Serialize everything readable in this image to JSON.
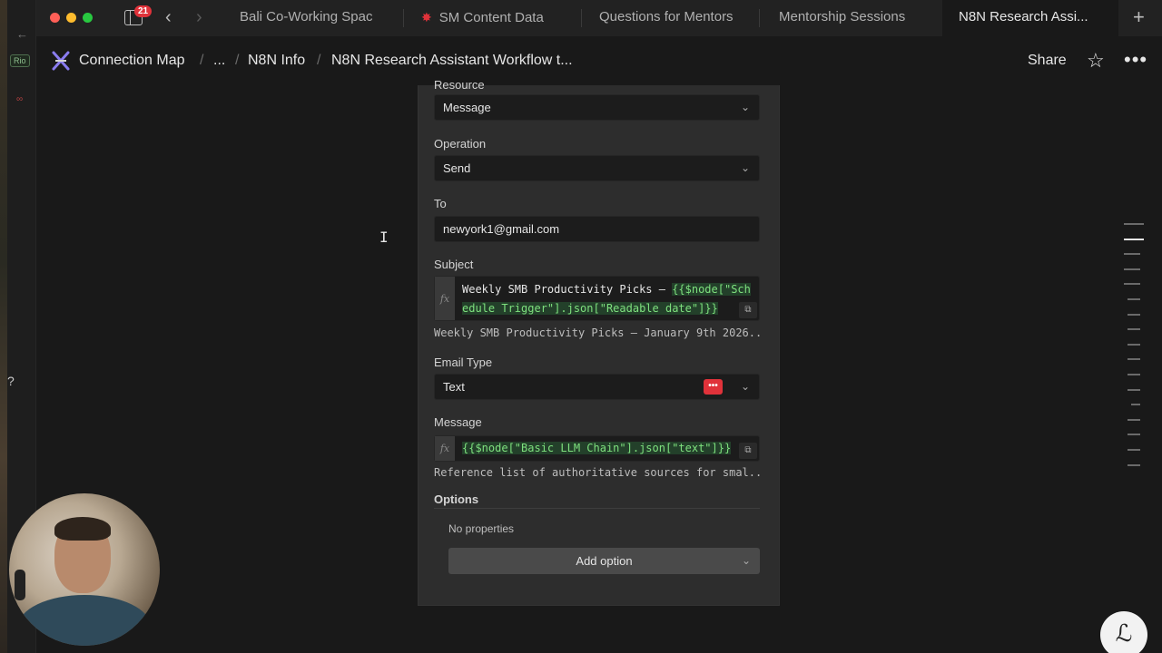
{
  "browser": {
    "tab_count_badge": "21",
    "tabs": [
      {
        "label": "Bali Co-Working Spac"
      },
      {
        "label": "SM Content Data"
      },
      {
        "label": "Questions for Mentors"
      },
      {
        "label": "Mentorship Sessions"
      },
      {
        "label": "N8N Research Assi..."
      }
    ],
    "icons": {
      "back": "chevron-left-icon",
      "forward": "chevron-right-icon",
      "new_tab": "plus-icon"
    }
  },
  "mini_sidebar": {
    "tag": "Rio"
  },
  "header": {
    "workspace": "Connection Map",
    "ellipsis": "...",
    "parent": "N8N Info",
    "page_title": "N8N Research Assistant Workflow t...",
    "share_label": "Share"
  },
  "form": {
    "resource_label": "Resource",
    "resource_value": "Message",
    "operation_label": "Operation",
    "operation_value": "Send",
    "to_label": "To",
    "to_value": "newyork1@gmail.com",
    "subject_label": "Subject",
    "subject_plain": "Weekly SMB Productivity Picks – ",
    "subject_expr": "{{$node[\"Schedule Trigger\"].json[\"Readable date\"]}}",
    "subject_preview": "Weekly SMB Productivity Picks – January 9th 2026...",
    "email_type_label": "Email Type",
    "email_type_value": "Text",
    "message_label": "Message",
    "message_expr": "{{$node[\"Basic LLM Chain\"].json[\"text\"]}}",
    "message_preview": "Reference list of authoritative sources for smal...",
    "options_label": "Options",
    "no_properties": "No properties",
    "add_option_label": "Add option"
  },
  "colors": {
    "accent_red": "#e0323a",
    "expr_green": "#7ee07e"
  }
}
